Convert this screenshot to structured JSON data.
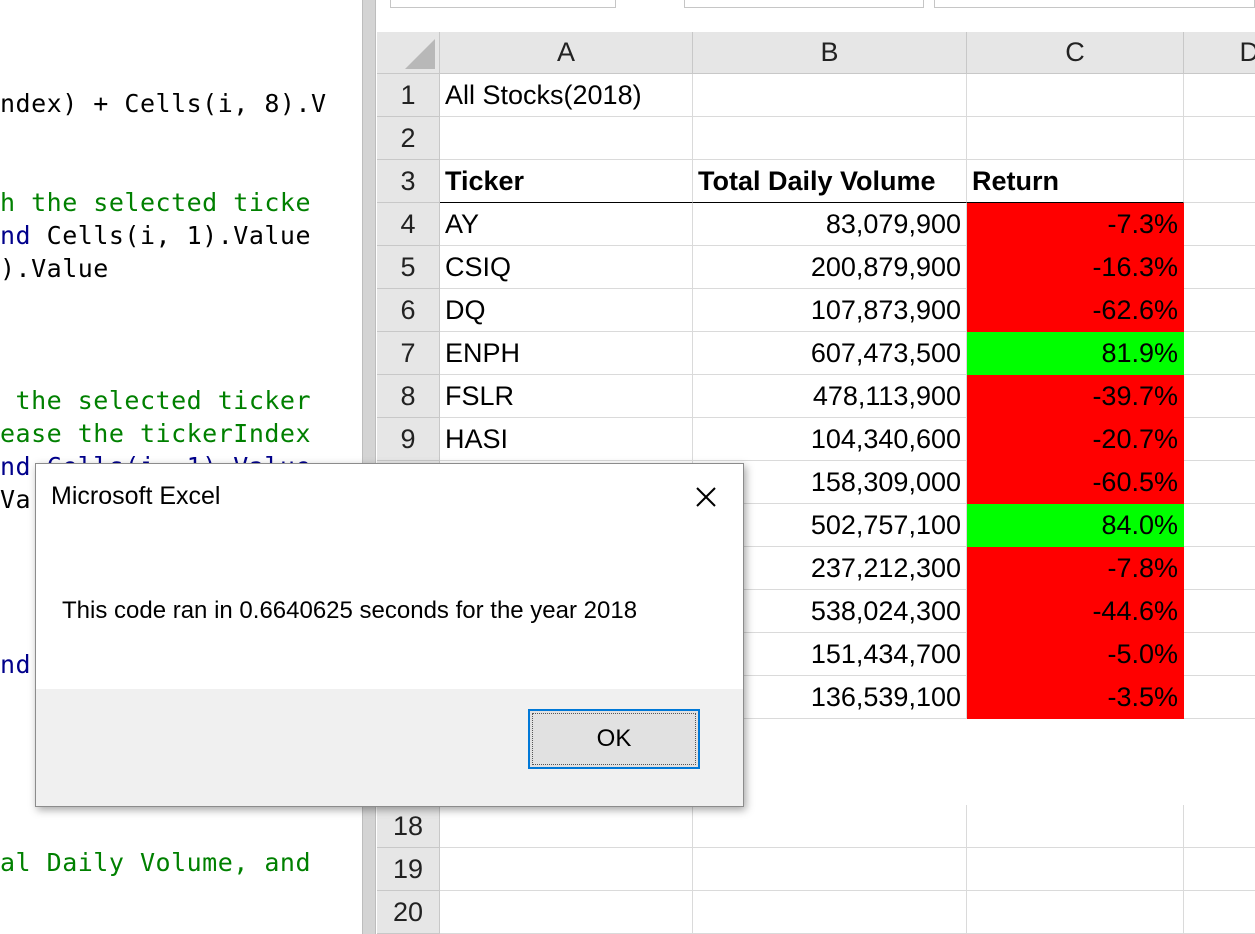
{
  "code_editor": {
    "lines": [
      {
        "text": "ndex) + Cells(i, 8).V",
        "kind": "default"
      },
      {
        "text": "h the selected ticke",
        "kind": "comment"
      },
      {
        "text": "nd",
        "kind": "keyword"
      },
      {
        "text": " Cells(i, 1).Value",
        "kind": "default"
      },
      {
        "text": ").Value",
        "kind": "default"
      },
      {
        "text": " the selected ticker",
        "kind": "comment"
      },
      {
        "text": "ease the tickerIndex",
        "kind": "comment"
      },
      {
        "text": "nd Cells(i, 1).Value",
        "kind": "keyword"
      },
      {
        "text": "Va",
        "kind": "default"
      },
      {
        "text": "nd",
        "kind": "keyword"
      },
      {
        "text": "al Daily Volume, and",
        "kind": "comment"
      }
    ]
  },
  "sheet": {
    "columns": [
      "A",
      "B",
      "C",
      "D"
    ],
    "row_numbers": [
      "1",
      "2",
      "3",
      "4",
      "5",
      "6",
      "7",
      "8",
      "9",
      "18",
      "19",
      "20"
    ],
    "title": "All Stocks(2018)",
    "headers": {
      "ticker": "Ticker",
      "volume": "Total Daily Volume",
      "return": "Return"
    },
    "rows": [
      {
        "ticker": "AY",
        "volume": "83,079,900",
        "return": "-7.3%",
        "status": "negative"
      },
      {
        "ticker": "CSIQ",
        "volume": "200,879,900",
        "return": "-16.3%",
        "status": "negative"
      },
      {
        "ticker": "DQ",
        "volume": "107,873,900",
        "return": "-62.6%",
        "status": "negative"
      },
      {
        "ticker": "ENPH",
        "volume": "607,473,500",
        "return": "81.9%",
        "status": "positive"
      },
      {
        "ticker": "FSLR",
        "volume": "478,113,900",
        "return": "-39.7%",
        "status": "negative"
      },
      {
        "ticker": "HASI",
        "volume": "104,340,600",
        "return": "-20.7%",
        "status": "negative"
      },
      {
        "ticker": "",
        "volume": "158,309,000",
        "return": "-60.5%",
        "status": "negative"
      },
      {
        "ticker": "",
        "volume": "502,757,100",
        "return": "84.0%",
        "status": "positive"
      },
      {
        "ticker": "",
        "volume": "237,212,300",
        "return": "-7.8%",
        "status": "negative"
      },
      {
        "ticker": "",
        "volume": "538,024,300",
        "return": "-44.6%",
        "status": "negative"
      },
      {
        "ticker": "",
        "volume": "151,434,700",
        "return": "-5.0%",
        "status": "negative"
      },
      {
        "ticker": "",
        "volume": "136,539,100",
        "return": "-3.5%",
        "status": "negative"
      }
    ],
    "colors": {
      "negative": "#ff0000",
      "positive": "#00ff00"
    }
  },
  "dialog": {
    "title": "Microsoft Excel",
    "message": "This code ran in 0.6640625 seconds for the year 2018",
    "ok_label": "OK",
    "close_icon": "close-icon"
  }
}
